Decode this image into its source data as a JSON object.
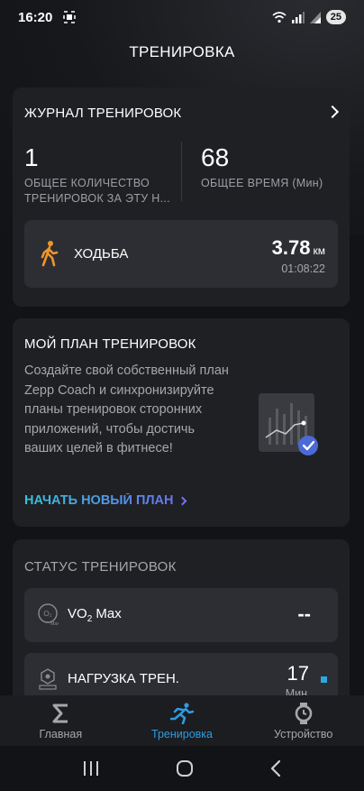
{
  "status_bar": {
    "time": "16:20",
    "battery": "25"
  },
  "title": "ТРЕНИРОВКА",
  "journal": {
    "header": "ЖУРНАЛ ТРЕНИРОВОК",
    "total_count": "1",
    "total_count_label": "ОБЩЕЕ КОЛИЧЕСТВО ТРЕНИРОВОК ЗА ЭТУ Н...",
    "total_time": "68",
    "total_time_label": "ОБЩЕЕ ВРЕМЯ (Мин)",
    "activity": {
      "name": "ХОДЬБА",
      "distance": "3.78",
      "distance_unit": "км",
      "duration": "01:08:22",
      "icon": "walking-icon"
    }
  },
  "plan": {
    "header": "МОЙ ПЛАН ТРЕНИРОВОК",
    "description": "Создайте свой собственный план Zepp Coach и синхронизируйте планы тренировок сторонних приложений, чтобы достичь ваших целей в фитнесе!",
    "link": "НАЧАТЬ НОВЫЙ ПЛАН"
  },
  "training_status": {
    "header": "СТАТУС ТРЕНИРОВОК",
    "vo2": {
      "label": "VO",
      "sub": "2",
      "label_rest": " Max",
      "value": "--"
    },
    "load": {
      "label": "НАГРУЗКА ТРЕН.",
      "value": "17",
      "unit": "Мин"
    }
  },
  "bottom_nav": [
    {
      "label": "Главная",
      "icon": "sigma-icon",
      "active": false
    },
    {
      "label": "Тренировка",
      "icon": "running-icon",
      "active": true
    },
    {
      "label": "Устройство",
      "icon": "watch-icon",
      "active": false
    }
  ],
  "colors": {
    "accent": "#2e9be0",
    "walk": "#f0952a",
    "card": "#1f2024"
  }
}
